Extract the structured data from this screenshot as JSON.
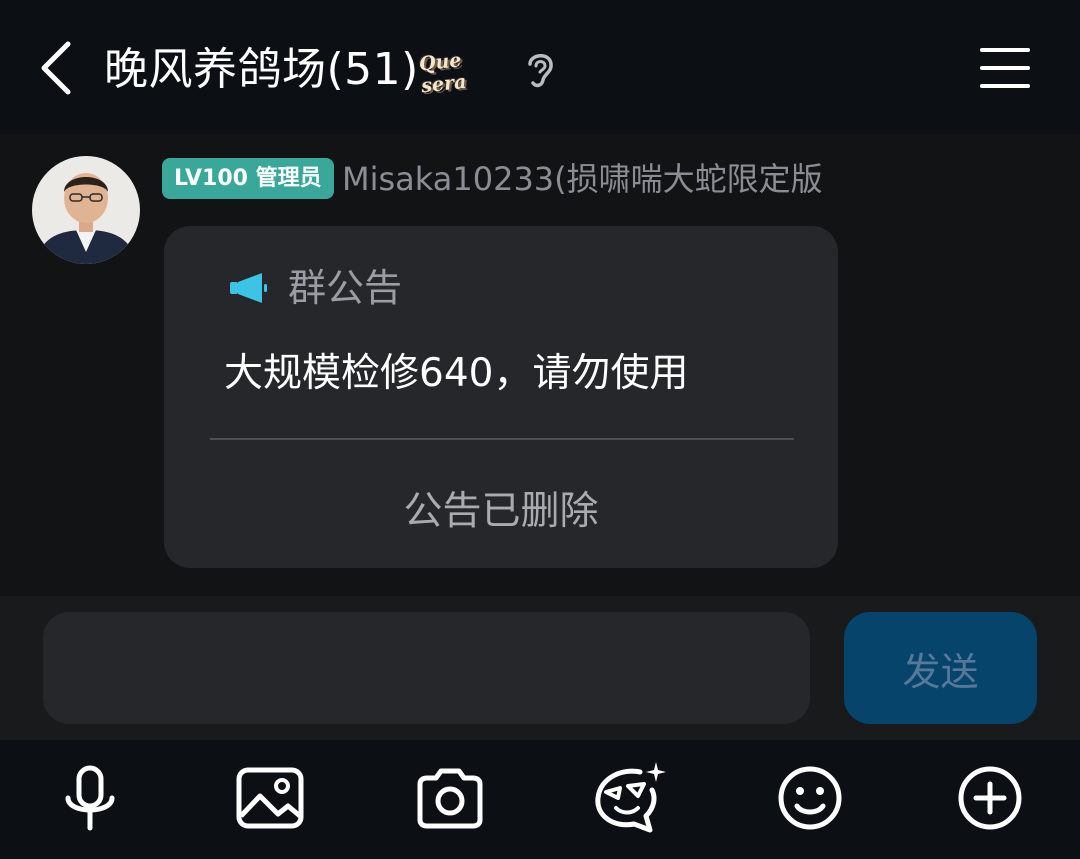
{
  "header": {
    "title": "晚风养鸽场(51)",
    "brand_badge": "Que sera",
    "back_icon": "chevron-left-icon",
    "hearing_icon": "ear-icon",
    "menu_icon": "hamburger-menu-icon"
  },
  "message": {
    "avatar_icon": "user-avatar",
    "level_badge": "LV100 管理员",
    "sender": "Misaka10233(损啸喘大蛇限定版",
    "notice": {
      "icon": "megaphone-icon",
      "label": "群公告",
      "body": "大规模检修640，请勿使用",
      "status": "公告已删除"
    }
  },
  "composer": {
    "input_value": "",
    "send_label": "发送"
  },
  "toolbar": {
    "items": [
      "microphone-icon",
      "image-icon",
      "camera-icon",
      "sticker-icon",
      "emoji-icon",
      "plus-icon"
    ]
  },
  "colors": {
    "header_bg": "#0c0f14",
    "chat_bg": "#121314",
    "card_bg": "#25272b",
    "badge_bg": "#3aa79b",
    "send_bg": "#07446b",
    "notice_icon": "#3cc4e6"
  }
}
